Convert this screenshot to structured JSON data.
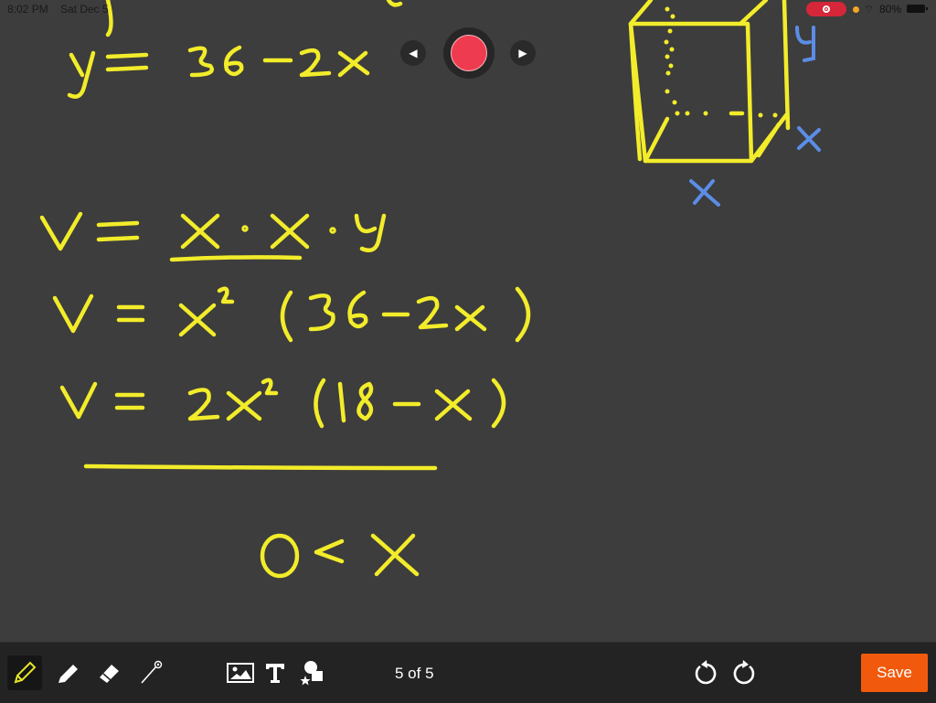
{
  "status_bar": {
    "time": "8:02 PM",
    "date": "Sat Dec 5",
    "battery": "80%",
    "recording_indicator_color": "#d6263a"
  },
  "playback": {
    "prev_icon": "◀",
    "next_icon": "▶",
    "record_color": "#ef3b4f"
  },
  "whiteboard": {
    "ink_color": "#f2ec2a",
    "label_color": "#5b8de6",
    "lines": [
      "y = 36 - 2x",
      "V = x · x · y",
      "V = x² (36 - 2x)",
      "V = 2x² (18 - x)",
      "0 < x"
    ],
    "diagram_labels": [
      "y",
      "x",
      "x"
    ]
  },
  "toolbar": {
    "tools": [
      "pencil",
      "marker",
      "eraser",
      "laser-pointer",
      "image",
      "text",
      "shapes"
    ],
    "active_tool": "pencil",
    "page_indicator": "5 of 5",
    "save_label": "Save",
    "save_color": "#f15a0c"
  }
}
